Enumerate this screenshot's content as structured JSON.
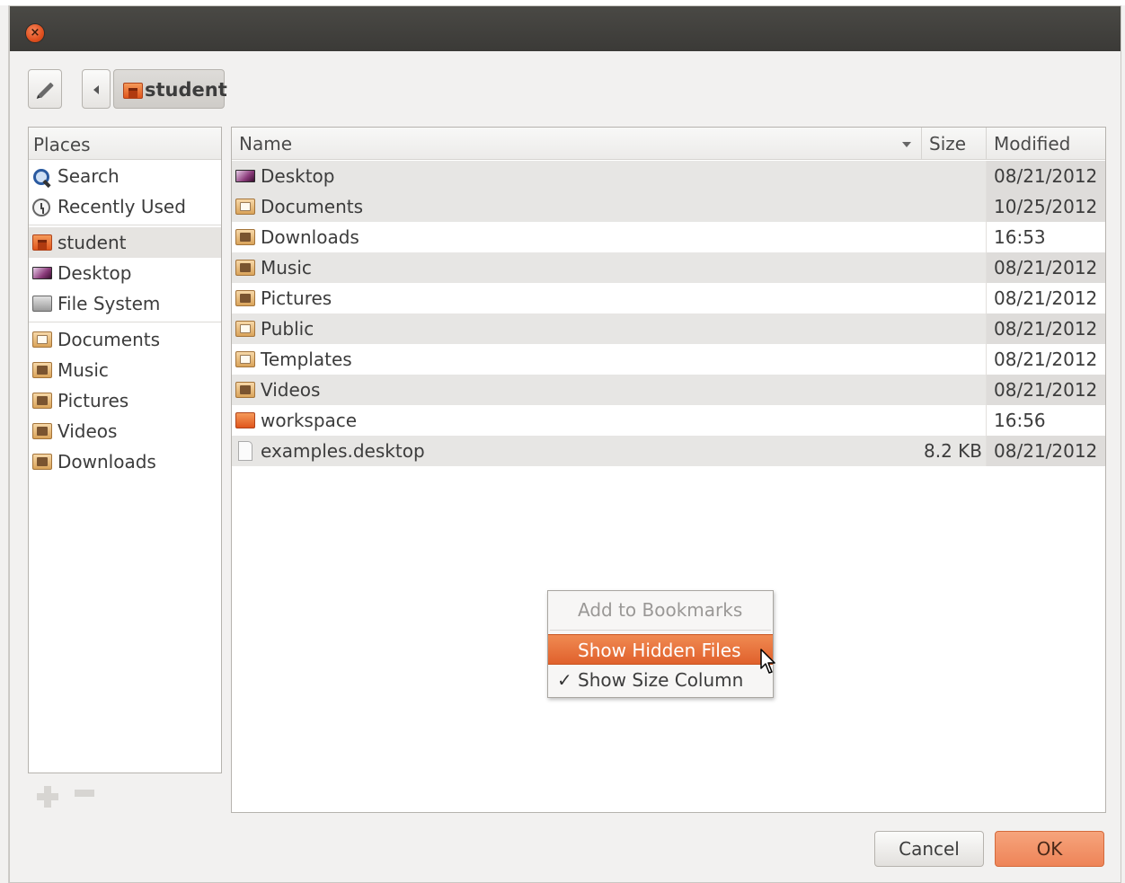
{
  "toolbar": {
    "breadcrumb_label": "student"
  },
  "places": {
    "header": "Places",
    "items": [
      {
        "label": "Search",
        "icon": "search-icon"
      },
      {
        "label": "Recently Used",
        "icon": "clock-icon"
      },
      {
        "label": "student",
        "icon": "home-folder-icon",
        "selected": true
      },
      {
        "label": "Desktop",
        "icon": "desktop-icon"
      },
      {
        "label": "File System",
        "icon": "drive-icon"
      },
      {
        "label": "Documents",
        "icon": "documents-folder-icon"
      },
      {
        "label": "Music",
        "icon": "music-folder-icon"
      },
      {
        "label": "Pictures",
        "icon": "pictures-folder-icon"
      },
      {
        "label": "Videos",
        "icon": "videos-folder-icon"
      },
      {
        "label": "Downloads",
        "icon": "downloads-folder-icon"
      }
    ]
  },
  "files": {
    "columns": {
      "name": "Name",
      "size": "Size",
      "modified": "Modified"
    },
    "rows": [
      {
        "name": "Desktop",
        "size": "",
        "modified": "08/21/2012",
        "icon": "desktop-icon"
      },
      {
        "name": "Documents",
        "size": "",
        "modified": "10/25/2012",
        "icon": "documents-folder-icon"
      },
      {
        "name": "Downloads",
        "size": "",
        "modified": "16:53",
        "icon": "downloads-folder-icon"
      },
      {
        "name": "Music",
        "size": "",
        "modified": "08/21/2012",
        "icon": "music-folder-icon"
      },
      {
        "name": "Pictures",
        "size": "",
        "modified": "08/21/2012",
        "icon": "pictures-folder-icon"
      },
      {
        "name": "Public",
        "size": "",
        "modified": "08/21/2012",
        "icon": "public-folder-icon"
      },
      {
        "name": "Templates",
        "size": "",
        "modified": "08/21/2012",
        "icon": "templates-folder-icon"
      },
      {
        "name": "Videos",
        "size": "",
        "modified": "08/21/2012",
        "icon": "videos-folder-icon"
      },
      {
        "name": "workspace",
        "size": "",
        "modified": "16:56",
        "icon": "folder-icon"
      },
      {
        "name": "examples.desktop",
        "size": "8.2 KB",
        "modified": "08/21/2012",
        "icon": "file-icon"
      }
    ]
  },
  "context_menu": {
    "items": [
      {
        "label": "Add to Bookmarks",
        "state": "disabled"
      },
      {
        "label": "Show Hidden Files",
        "state": "hover"
      },
      {
        "label": "Show Size Column",
        "state": "checked"
      }
    ],
    "check_glyph": "✓"
  },
  "buttons": {
    "cancel": "Cancel",
    "ok": "OK"
  },
  "colors": {
    "accent": "#e0612c",
    "title_bar": "#3b3a37",
    "window_bg": "#f2f1f0"
  }
}
